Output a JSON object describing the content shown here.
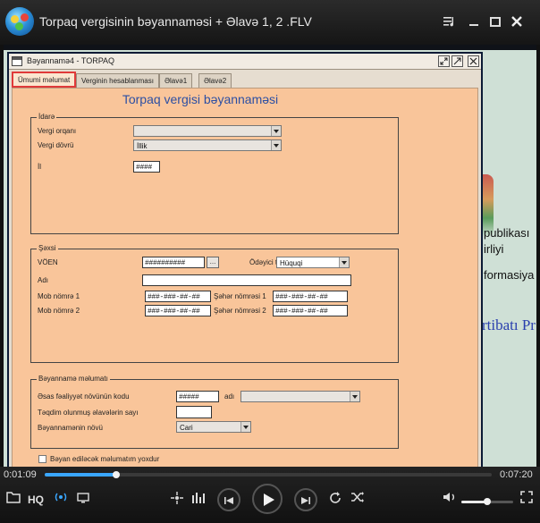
{
  "player": {
    "title": "Torpaq vergisinin bəyannaməsi + Əlavə 1, 2 .FLV",
    "current_time": "0:01:09",
    "total_time": "0:07:20",
    "progress_fraction": 0.16,
    "volume_fraction": 0.5,
    "hq_label": "HQ"
  },
  "background_page": {
    "line1": "publikası",
    "line2": "irliyi",
    "line3": "formasiya",
    "line4": "rtibatı Pr"
  },
  "window": {
    "title": "Bəyannamə4 - TORPAQ",
    "tabs": [
      "Ümumi məlumat",
      "Verginin hesablanması",
      "Əlavə1",
      "Əlavə2"
    ],
    "form_title": "Torpaq vergisi bəyannaməsi"
  },
  "idare": {
    "legend": "İdarə",
    "vergi_orqani_label": "Vergi orqanı",
    "vergi_orqani_value": "",
    "vergi_dovru_label": "Vergi dövrü",
    "vergi_dovru_value": "İllik",
    "il_label": "İl",
    "il_value": "####"
  },
  "sexsi": {
    "legend": "Şəxsi",
    "voen_label": "VÖEN",
    "voen_value": "##########",
    "voen_button": "...",
    "odeyici_label": "Ödəyici tipi",
    "odeyici_value": "Hüquqi",
    "adi_label": "Adı",
    "adi_value": "",
    "mob1_label": "Mob nömrə 1",
    "mob1_value": "###-###-##-##",
    "mob2_label": "Mob nömrə 2",
    "mob2_value": "###-###-##-##",
    "seher1_label": "Şəhər nömrəsi 1",
    "seher1_value": "###-###-##-##",
    "seher2_label": "Şəhər nömrəsi 2",
    "seher2_value": "###-###-##-##"
  },
  "beyanname": {
    "legend": "Bəyannamə məlumatı",
    "kod_label": "Əsas fəaliyyət növünün kodu",
    "kod_value": "#####",
    "adi_label": "adı",
    "adi_value": "",
    "elave_label": "Təqdim olunmuş əlavələrin sayı",
    "elave_value": "",
    "nov_label": "Bəyannamənin növü",
    "nov_value": "Cari"
  },
  "footer": {
    "checkbox_label": "Bəyan ediləcək məlumatım yoxdur"
  },
  "colors": {
    "panel_bg": "#f9c59a",
    "title_blue": "#2c4fa3",
    "active_tab_border": "#e03a3a",
    "seek_accent": "#3aa7ff"
  }
}
